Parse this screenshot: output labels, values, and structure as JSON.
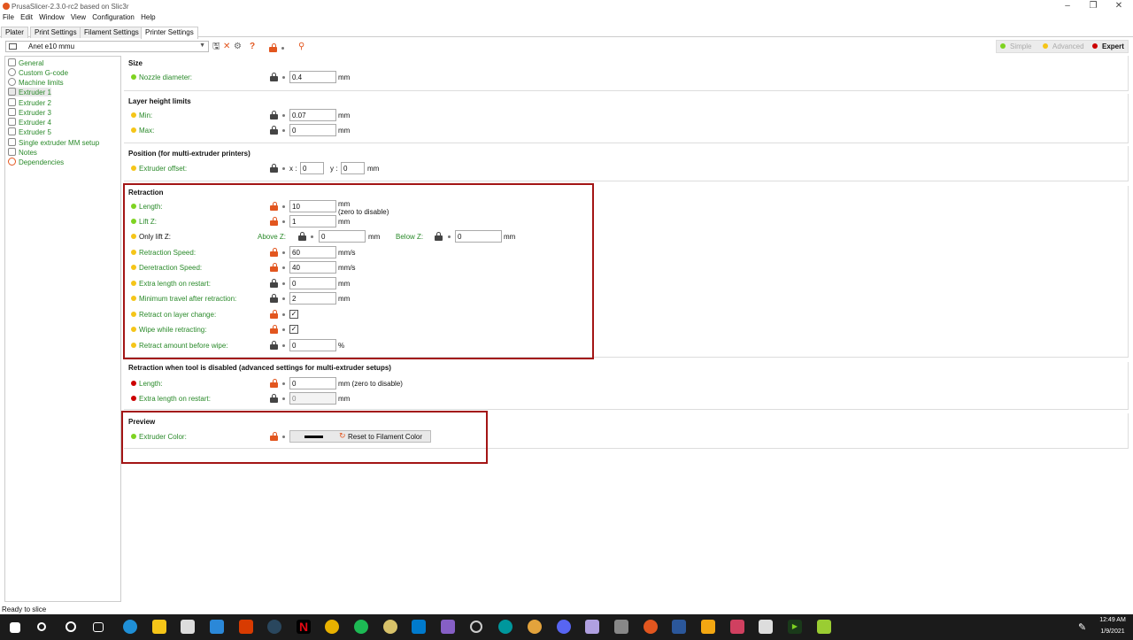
{
  "window": {
    "title": "PrusaSlicer-2.3.0-rc2 based on Slic3r"
  },
  "menu": [
    "File",
    "Edit",
    "Window",
    "View",
    "Configuration",
    "Help"
  ],
  "tabs": [
    "Plater",
    "Print Settings",
    "Filament Settings",
    "Printer Settings"
  ],
  "preset": {
    "selected": "Anet e10 mmu"
  },
  "modes": {
    "simple": "Simple",
    "advanced": "Advanced",
    "expert": "Expert",
    "colors": {
      "simple": "#7ed321",
      "advanced": "#f5c518",
      "expert": "#cc0000"
    }
  },
  "sidebar": [
    "General",
    "Custom G-code",
    "Machine limits",
    "Extruder 1",
    "Extruder 2",
    "Extruder 3",
    "Extruder 4",
    "Extruder 5",
    "Single extruder MM setup",
    "Notes",
    "Dependencies"
  ],
  "size": {
    "title": "Size",
    "nozzle_label": "Nozzle diameter:",
    "nozzle_value": "0.4",
    "unit": "mm"
  },
  "layer": {
    "title": "Layer height limits",
    "min_label": "Min:",
    "min_value": "0.07",
    "max_label": "Max:",
    "max_value": "0",
    "unit": "mm"
  },
  "position": {
    "title": "Position (for multi-extruder printers)",
    "label": "Extruder offset:",
    "x_label": "x :",
    "x_value": "0",
    "y_label": "y :",
    "y_value": "0",
    "unit": "mm"
  },
  "retraction": {
    "title": "Retraction",
    "length_label": "Length:",
    "length_value": "10",
    "length_unit": "mm",
    "length_note": "(zero to disable)",
    "liftz_label": "Lift Z:",
    "liftz_value": "1",
    "liftz_unit": "mm",
    "onlylift_label": "Only lift Z:",
    "above_label": "Above Z:",
    "above_value": "0",
    "above_unit": "mm",
    "below_label": "Below Z:",
    "below_value": "0",
    "below_unit": "mm",
    "speed_label": "Retraction Speed:",
    "speed_value": "60",
    "speed_unit": "mm/s",
    "despeed_label": "Deretraction Speed:",
    "despeed_value": "40",
    "despeed_unit": "mm/s",
    "extra_label": "Extra length on restart:",
    "extra_value": "0",
    "extra_unit": "mm",
    "mintravel_label": "Minimum travel after retraction:",
    "mintravel_value": "2",
    "mintravel_unit": "mm",
    "layerchange_label": "Retract on layer change:",
    "wipe_label": "Wipe while retracting:",
    "beforewipe_label": "Retract amount before wipe:",
    "beforewipe_value": "0",
    "beforewipe_unit": "%"
  },
  "toolretraction": {
    "title": "Retraction when tool is disabled (advanced settings for multi-extruder setups)",
    "length_label": "Length:",
    "length_value": "0",
    "length_unit": "mm (zero to disable)",
    "extra_label": "Extra length on restart:",
    "extra_value": "0",
    "extra_unit": "mm"
  },
  "preview": {
    "title": "Preview",
    "color_label": "Extruder Color:",
    "reset_label": "Reset to Filament Color"
  },
  "status": "Ready to slice",
  "clock": {
    "time": "12:49 AM",
    "date": "1/9/2021"
  }
}
